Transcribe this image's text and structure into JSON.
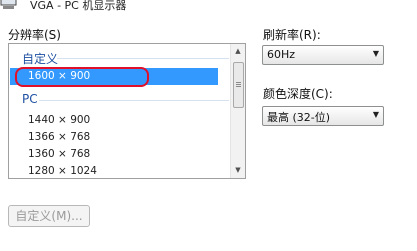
{
  "window": {
    "title": "VGA - PC 机显示器"
  },
  "resolution": {
    "label": "分辨率(S)",
    "groups": [
      {
        "name": "自定义",
        "items": [
          "1600 × 900"
        ]
      },
      {
        "name": "PC",
        "items": [
          "1440 × 900",
          "1366 × 768",
          "1360 × 768",
          "1280 × 1024"
        ]
      }
    ],
    "selected": "1600 × 900"
  },
  "refresh_rate": {
    "label": "刷新率(R):",
    "value": "60Hz"
  },
  "color_depth": {
    "label": "颜色深度(C):",
    "value": "最高 (32-位)"
  },
  "buttons": {
    "custom": "自定义(M)..."
  },
  "icons": {
    "monitor": "monitor-icon",
    "scroll_up": "scroll-up-arrow-icon",
    "scroll_down": "scroll-down-arrow-icon",
    "combo_dropdown": "chevron-down-icon"
  },
  "colors": {
    "selection": "#3399ff",
    "group_header": "#1e50a2",
    "annotation_ring": "#e0102a"
  }
}
